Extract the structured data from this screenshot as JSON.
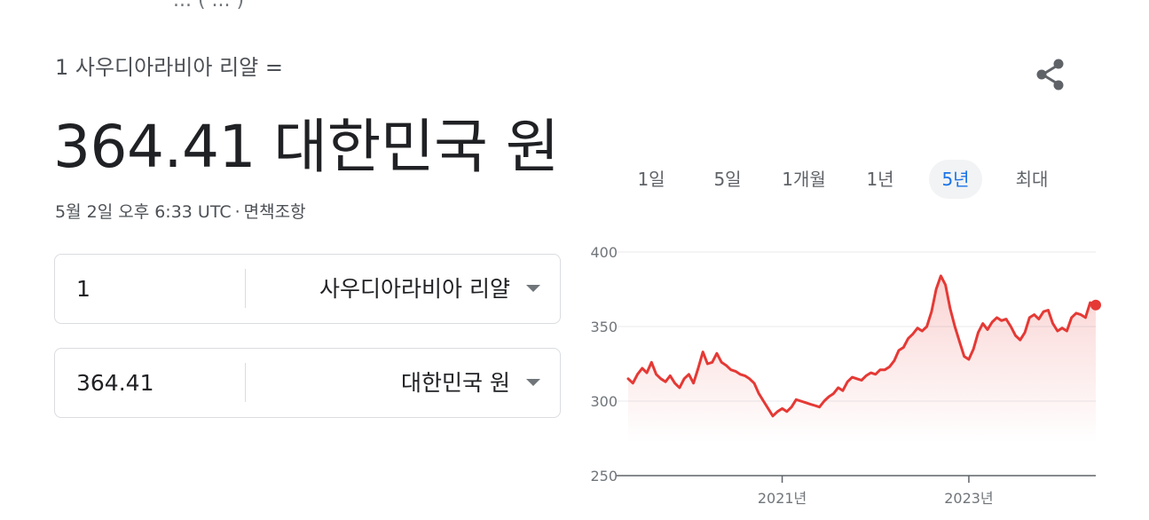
{
  "header_cut_text": "...  (  ...  )",
  "converter": {
    "from_label": "1 사우디아라비아 리얄 =",
    "result": "364.41 대한민국 원",
    "timestamp": "5월 2일 오후 6:33 UTC",
    "separator": "·",
    "disclaimer": "면책조항",
    "from_amount": "1",
    "from_currency": "사우디아라비아 리얄",
    "to_amount": "364.41",
    "to_currency": "대한민국 원"
  },
  "share_icon": "share-icon",
  "ranges": [
    {
      "label": "1일",
      "active": false
    },
    {
      "label": "5일",
      "active": false
    },
    {
      "label": "1개월",
      "active": false
    },
    {
      "label": "1년",
      "active": false
    },
    {
      "label": "5년",
      "active": true
    },
    {
      "label": "최대",
      "active": false
    }
  ],
  "colors": {
    "line": "#e53935",
    "active_range": "#1a73e8",
    "grid": "#e8eaed"
  },
  "chart_data": {
    "type": "area",
    "ylim": [
      250,
      400
    ],
    "y_ticks": [
      400,
      350,
      300,
      250
    ],
    "x_tick_labels": [
      {
        "label": "2021년",
        "x": 2021.0
      },
      {
        "label": "2023년",
        "x": 2023.0
      }
    ],
    "xlim": [
      2019.35,
      2024.36
    ],
    "grid": true,
    "series": [
      {
        "values": [
          [
            2019.35,
            315
          ],
          [
            2019.4,
            312
          ],
          [
            2019.45,
            318
          ],
          [
            2019.5,
            322
          ],
          [
            2019.55,
            319
          ],
          [
            2019.6,
            326
          ],
          [
            2019.65,
            318
          ],
          [
            2019.7,
            315
          ],
          [
            2019.75,
            313
          ],
          [
            2019.8,
            317
          ],
          [
            2019.85,
            312
          ],
          [
            2019.9,
            309
          ],
          [
            2019.95,
            315
          ],
          [
            2020.0,
            318
          ],
          [
            2020.05,
            312
          ],
          [
            2020.1,
            322
          ],
          [
            2020.15,
            333
          ],
          [
            2020.2,
            325
          ],
          [
            2020.25,
            326
          ],
          [
            2020.3,
            332
          ],
          [
            2020.35,
            326
          ],
          [
            2020.4,
            324
          ],
          [
            2020.45,
            321
          ],
          [
            2020.5,
            320
          ],
          [
            2020.55,
            318
          ],
          [
            2020.6,
            317
          ],
          [
            2020.65,
            315
          ],
          [
            2020.7,
            312
          ],
          [
            2020.75,
            305
          ],
          [
            2020.8,
            300
          ],
          [
            2020.85,
            295
          ],
          [
            2020.9,
            290
          ],
          [
            2020.95,
            293
          ],
          [
            2021.0,
            295
          ],
          [
            2021.05,
            293
          ],
          [
            2021.1,
            296
          ],
          [
            2021.15,
            301
          ],
          [
            2021.2,
            300
          ],
          [
            2021.25,
            299
          ],
          [
            2021.3,
            298
          ],
          [
            2021.35,
            297
          ],
          [
            2021.4,
            296
          ],
          [
            2021.45,
            300
          ],
          [
            2021.5,
            303
          ],
          [
            2021.55,
            305
          ],
          [
            2021.6,
            309
          ],
          [
            2021.65,
            307
          ],
          [
            2021.7,
            313
          ],
          [
            2021.75,
            316
          ],
          [
            2021.8,
            315
          ],
          [
            2021.85,
            314
          ],
          [
            2021.9,
            317
          ],
          [
            2021.95,
            319
          ],
          [
            2022.0,
            318
          ],
          [
            2022.05,
            321
          ],
          [
            2022.1,
            321
          ],
          [
            2022.15,
            323
          ],
          [
            2022.2,
            327
          ],
          [
            2022.25,
            334
          ],
          [
            2022.3,
            336
          ],
          [
            2022.35,
            342
          ],
          [
            2022.4,
            345
          ],
          [
            2022.45,
            349
          ],
          [
            2022.5,
            347
          ],
          [
            2022.55,
            350
          ],
          [
            2022.6,
            360
          ],
          [
            2022.65,
            375
          ],
          [
            2022.7,
            384
          ],
          [
            2022.75,
            378
          ],
          [
            2022.8,
            362
          ],
          [
            2022.85,
            350
          ],
          [
            2022.9,
            340
          ],
          [
            2022.95,
            330
          ],
          [
            2023.0,
            328
          ],
          [
            2023.05,
            335
          ],
          [
            2023.1,
            346
          ],
          [
            2023.15,
            352
          ],
          [
            2023.2,
            348
          ],
          [
            2023.25,
            353
          ],
          [
            2023.3,
            356
          ],
          [
            2023.35,
            354
          ],
          [
            2023.4,
            355
          ],
          [
            2023.45,
            350
          ],
          [
            2023.5,
            344
          ],
          [
            2023.55,
            341
          ],
          [
            2023.6,
            346
          ],
          [
            2023.65,
            356
          ],
          [
            2023.7,
            358
          ],
          [
            2023.75,
            355
          ],
          [
            2023.8,
            360
          ],
          [
            2023.85,
            361
          ],
          [
            2023.9,
            352
          ],
          [
            2023.95,
            347
          ],
          [
            2024.0,
            349
          ],
          [
            2024.05,
            347
          ],
          [
            2024.1,
            356
          ],
          [
            2024.15,
            359
          ],
          [
            2024.2,
            358
          ],
          [
            2024.25,
            356
          ],
          [
            2024.3,
            366
          ],
          [
            2024.36,
            364.41
          ]
        ]
      }
    ]
  }
}
